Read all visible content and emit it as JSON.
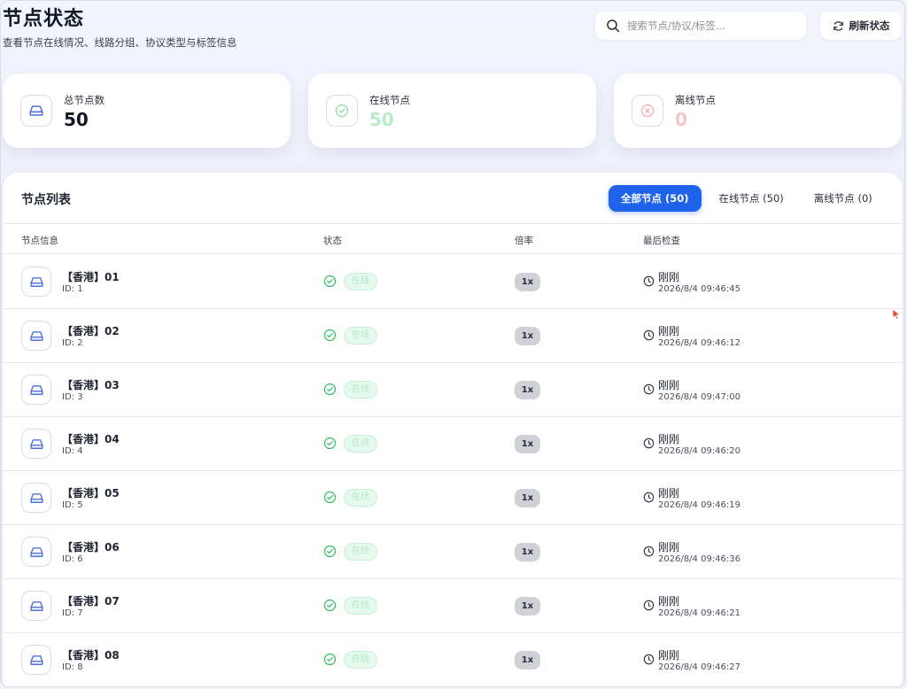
{
  "header": {
    "title": "节点状态",
    "subtitle": "查看节点在线情况、线路分组、协议类型与标签信息",
    "search_placeholder": "搜索节点/协议/标签...",
    "refresh_label": "刷新状态"
  },
  "stats": [
    {
      "label": "总节点数",
      "value": "50",
      "icon": "server-icon",
      "color": "#111827"
    },
    {
      "label": "在线节点",
      "value": "50",
      "icon": "check-circle-icon",
      "color": "#b6ecc8"
    },
    {
      "label": "离线节点",
      "value": "0",
      "icon": "x-circle-icon",
      "color": "#f6c4c4"
    }
  ],
  "list": {
    "title": "节点列表",
    "tabs": [
      {
        "label": "全部节点 (50)",
        "active": true
      },
      {
        "label": "在线节点 (50)",
        "active": false
      },
      {
        "label": "离线节点 (0)",
        "active": false
      }
    ],
    "columns": [
      "节点信息",
      "状态",
      "倍率",
      "最后检查"
    ],
    "rows": [
      {
        "name": "【香港】01",
        "id": "ID: 1",
        "status": "在线",
        "rate": "1x",
        "ago": "刚刚",
        "time": "2026/8/4 09:46:45"
      },
      {
        "name": "【香港】02",
        "id": "ID: 2",
        "status": "在线",
        "rate": "1x",
        "ago": "刚刚",
        "time": "2026/8/4 09:46:12"
      },
      {
        "name": "【香港】03",
        "id": "ID: 3",
        "status": "在线",
        "rate": "1x",
        "ago": "刚刚",
        "time": "2026/8/4 09:47:00"
      },
      {
        "name": "【香港】04",
        "id": "ID: 4",
        "status": "在线",
        "rate": "1x",
        "ago": "刚刚",
        "time": "2026/8/4 09:46:20"
      },
      {
        "name": "【香港】05",
        "id": "ID: 5",
        "status": "在线",
        "rate": "1x",
        "ago": "刚刚",
        "time": "2026/8/4 09:46:19"
      },
      {
        "name": "【香港】06",
        "id": "ID: 6",
        "status": "在线",
        "rate": "1x",
        "ago": "刚刚",
        "time": "2026/8/4 09:46:36"
      },
      {
        "name": "【香港】07",
        "id": "ID: 7",
        "status": "在线",
        "rate": "1x",
        "ago": "刚刚",
        "time": "2026/8/4 09:46:21"
      },
      {
        "name": "【香港】08",
        "id": "ID: 8",
        "status": "在线",
        "rate": "1x",
        "ago": "刚刚",
        "time": "2026/8/4 09:46:27"
      }
    ]
  },
  "colors": {
    "accent": "#1f63ec",
    "online_green": "#2fbf5f",
    "offline_red": "#e26a6a",
    "server_blue": "#3d63d8"
  }
}
